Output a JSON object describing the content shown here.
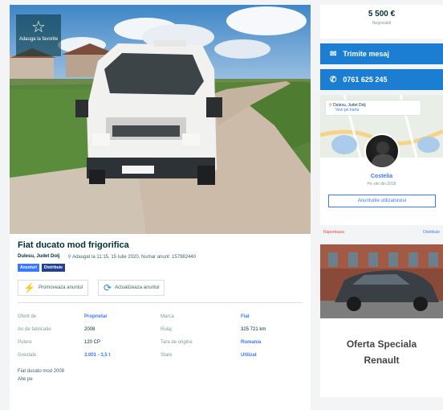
{
  "listing": {
    "favorite_label": "Adauga la favorite",
    "title": "Fiat ducato mod frigorifica",
    "location": "Dulesu, Judet Dolj",
    "meta": "Adaugat la 11:15, 15 Iulie 2020, Numar anunt: 157982440",
    "badges": [
      "Anunturi",
      "Distribuie"
    ],
    "actions": {
      "promote": "Promoveaza anuntul",
      "refresh": "Actualizeaza anuntul"
    },
    "details": [
      {
        "label": "Oferit de",
        "value": "Proprietar",
        "link": true
      },
      {
        "label": "Marca",
        "value": "Fiat",
        "link": true
      },
      {
        "label": "An de fabricatie",
        "value": "2008",
        "link": false
      },
      {
        "label": "Rulaj",
        "value": "325 721 km",
        "link": false
      },
      {
        "label": "Putere",
        "value": "120 CP",
        "link": false
      },
      {
        "label": "Tara de origine",
        "value": "Romania",
        "link": true
      },
      {
        "label": "Greutate",
        "value": "3.001 - 3,5 t",
        "link": true
      },
      {
        "label": "Stare",
        "value": "Utilizat",
        "link": true
      }
    ],
    "description_lines": [
      "Fiat ducato mod 2008",
      "Alte pe"
    ]
  },
  "sidebar": {
    "price": "5 500 €",
    "price_note": "Negociabil",
    "message_button": "Trimite mesaj",
    "phone_button": "0761 625 245",
    "location_label": "Dulesu, Judet Dolj",
    "see_map": "Vezi pe harta",
    "seller_name": "Costelia",
    "seller_since": "Pe site din 2018",
    "seller_ads_button": "Anunturile utilizatorului",
    "link_left": "Raporteaza",
    "link_right": "Distribuie",
    "ad_title_line1": "Oferta Speciala",
    "ad_title_line2": "Renault"
  },
  "colors": {
    "primary_button": "#1c7ed2",
    "link": "#3a77ff",
    "text_dark": "#002f34"
  }
}
